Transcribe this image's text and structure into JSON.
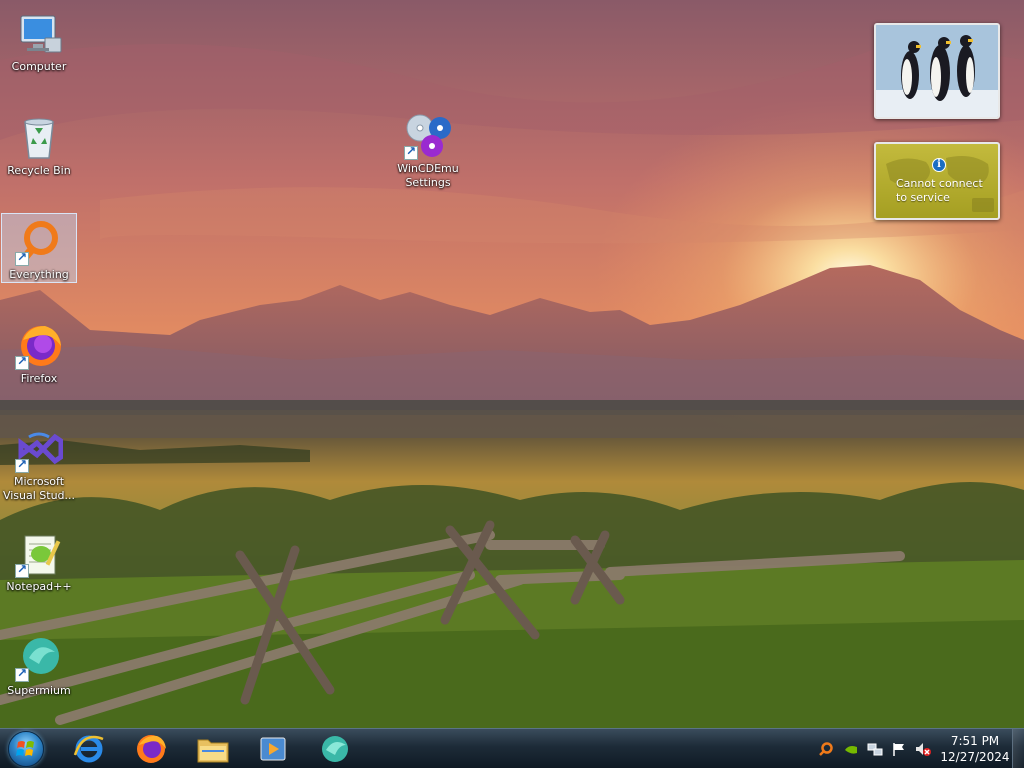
{
  "desktop": {
    "icons": [
      {
        "label": "Computer",
        "icon": "computer-icon"
      },
      {
        "label": "Recycle Bin",
        "icon": "recycle-bin-icon"
      },
      {
        "label": "Everything",
        "icon": "everything-search-icon",
        "selected": true
      },
      {
        "label": "Firefox",
        "icon": "firefox-icon"
      },
      {
        "label_line1": "Microsoft",
        "label_line2": "Visual Stud...",
        "icon": "visual-studio-icon"
      },
      {
        "label": "Notepad++",
        "icon": "notepad-plus-plus-icon"
      },
      {
        "label": "Supermium",
        "icon": "supermium-icon"
      },
      {
        "label_line1": "WinCDEmu",
        "label_line2": "Settings",
        "icon": "wincdemu-icon"
      }
    ]
  },
  "gadgets": {
    "slideshow": {
      "icon": "penguins-photo"
    },
    "weather": {
      "message": "Cannot connect to service",
      "icon": "info-icon"
    }
  },
  "taskbar": {
    "start": {
      "icon": "windows-start-orb"
    },
    "pinned": [
      {
        "name": "Internet Explorer",
        "icon": "internet-explorer-icon"
      },
      {
        "name": "Firefox",
        "icon": "firefox-icon"
      },
      {
        "name": "Windows Explorer",
        "icon": "folder-icon"
      },
      {
        "name": "Windows Media Player",
        "icon": "media-player-icon"
      },
      {
        "name": "Supermium",
        "icon": "supermium-icon"
      }
    ],
    "tray": {
      "icons": [
        "everything-tray-icon",
        "nvidia-icon",
        "network-icon",
        "action-center-flag-icon",
        "volume-muted-icon"
      ],
      "time": "7:51 PM",
      "date": "12/27/2024"
    }
  },
  "colors": {
    "taskbar": "#1d2b38",
    "weather_gadget": "#b5ae30",
    "selection": "#bed7f5"
  }
}
